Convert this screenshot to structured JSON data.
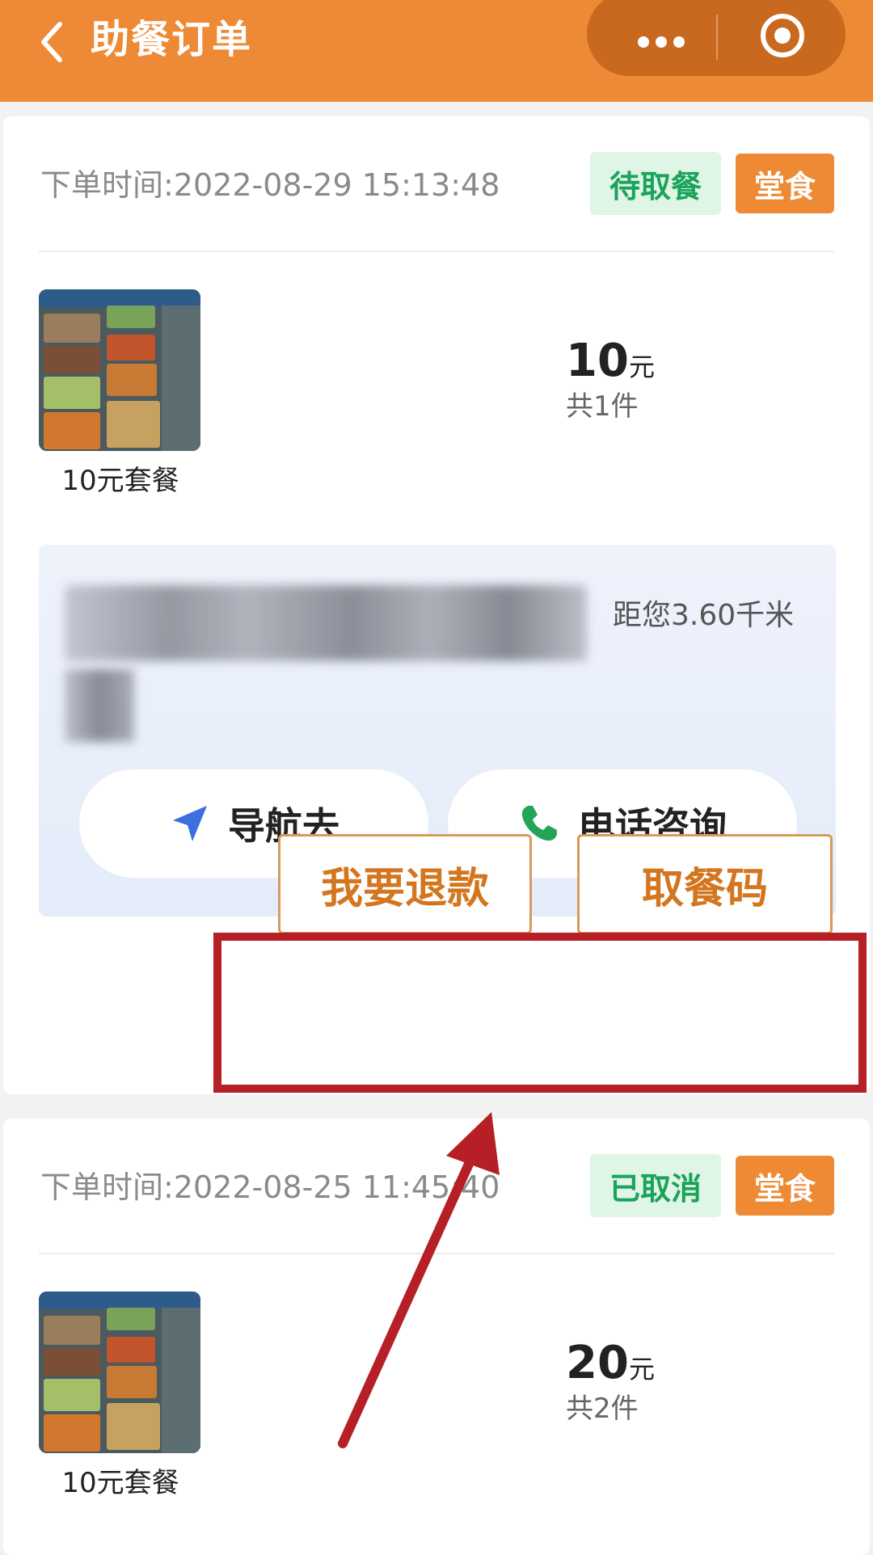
{
  "header": {
    "title": "助餐订单",
    "background": "#ee8a35"
  },
  "orders": [
    {
      "order_time": "下单时间:2022-08-29 15:13:48",
      "status": "待取餐",
      "type": "堂食",
      "item_name": "10元套餐",
      "price": "10",
      "price_unit": "元",
      "count": "共1件",
      "distance": "距您3.60千米",
      "nav_label": "导航去",
      "call_label": "电话咨询",
      "refund_label": "我要退款",
      "pickup_code_label": "取餐码"
    },
    {
      "order_time": "下单时间:2022-08-25 11:45:40",
      "status": "已取消",
      "type": "堂食",
      "item_name": "10元套餐",
      "price": "20",
      "price_unit": "元",
      "count": "共2件"
    }
  ],
  "icons": {
    "back": "chevron-left-icon",
    "more": "more-dots-icon",
    "target": "target-icon",
    "nav": "navigation-arrow-icon",
    "phone": "phone-icon"
  },
  "colors": {
    "accent": "#ee8a35",
    "status_green": "#1aa35a",
    "annotation_red": "#b51f25"
  }
}
